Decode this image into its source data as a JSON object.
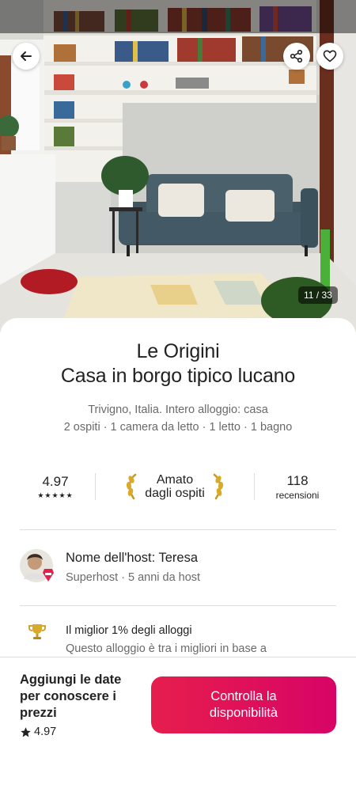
{
  "gallery": {
    "counter": "11 / 33",
    "back_icon": "arrow-left-icon",
    "share_icon": "share-icon",
    "favorite_icon": "heart-icon"
  },
  "listing": {
    "title_line1": "Le Origini",
    "title_line2": "Casa in borgo tipico lucano",
    "location_line": "Trivigno, Italia. Intero alloggio: casa",
    "details_line": "2 ospiti · 1 camera da letto · 1 letto · 1 bagno"
  },
  "stats": {
    "rating": "4.97",
    "stars": "★★★★★",
    "guest_favorite_line1": "Amato",
    "guest_favorite_line2": "dagli ospiti",
    "reviews_count": "118",
    "reviews_label": "recensioni"
  },
  "host": {
    "title": "Nome dell'host: Teresa",
    "meta": "Superhost · 5 anni da host"
  },
  "highlight": {
    "icon": "trophy-icon",
    "title": "Il miglior 1% degli alloggi",
    "description": "Questo alloggio è tra i migliori in base a"
  },
  "footer": {
    "price_prompt_line1": "Aggiungi le date",
    "price_prompt_line2": "per conoscere i",
    "price_prompt_line3": "prezzi",
    "rating": "4.97",
    "cta_line1": "Controlla la",
    "cta_line2": "disponibilità"
  },
  "colors": {
    "accent": "#e61e4d",
    "text": "#222222",
    "muted": "#6a6a6a"
  }
}
